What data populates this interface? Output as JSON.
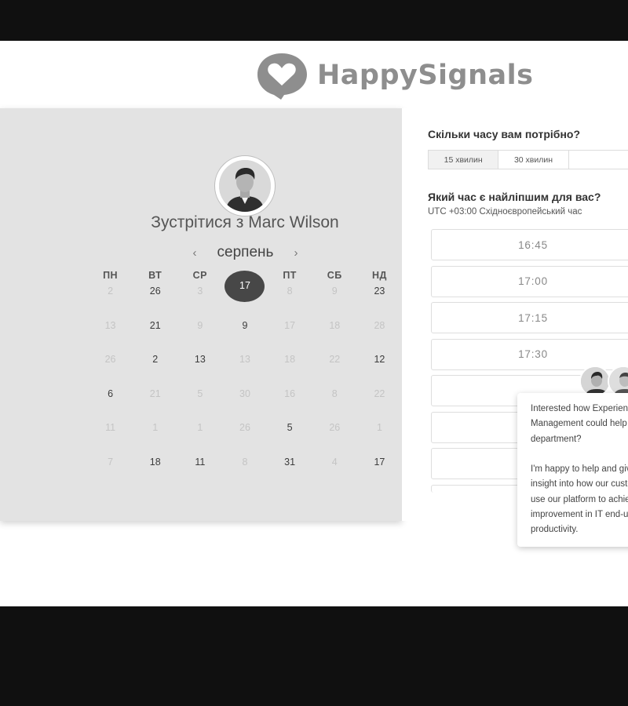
{
  "logo": {
    "text": "HappySignals"
  },
  "host": {
    "title": "Зустрітися з Marc Wilson"
  },
  "calendar": {
    "month": "серпень",
    "weekdays": [
      "ПН",
      "ВТ",
      "СР",
      "ЧТ",
      "ПТ",
      "СБ",
      "НД"
    ],
    "selected_day": "17",
    "rows": [
      [
        "2",
        "26",
        "3",
        "17",
        "8",
        "9",
        "23"
      ],
      [
        "13",
        "21",
        "9",
        "9",
        "17",
        "18",
        "28"
      ],
      [
        "26",
        "2",
        "13",
        "13",
        "18",
        "22",
        "12"
      ],
      [
        "6",
        "21",
        "5",
        "30",
        "16",
        "8",
        "22"
      ],
      [
        "11",
        "1",
        "1",
        "26",
        "5",
        "26",
        "1"
      ],
      [
        "7",
        "18",
        "11",
        "8",
        "31",
        "4",
        "17"
      ]
    ]
  },
  "duration": {
    "question": "Скільки часу вам потрібно?",
    "options": [
      "15 хвилин",
      "30 хвилин",
      ""
    ],
    "selected": "15 хвилин"
  },
  "time": {
    "question": "Який час є найліпшим для вас?",
    "timezone": "UTC +03:00 Східноєвропейський час",
    "slots": [
      "16:45",
      "17:00",
      "17:15",
      "17:30",
      "",
      "",
      "",
      ""
    ]
  },
  "chat": {
    "message": "Interested how Experience\nManagement could help your\ndepartment?\n\nI'm happy to help and give you\ninsight into how our customers\nuse our platform to achieve\nimprovement in IT end-user\nproductivity."
  },
  "colors": {
    "brand_gray": "#8e8e8e",
    "panel_bg": "#e3e3e3",
    "selected_day": "#474747"
  }
}
